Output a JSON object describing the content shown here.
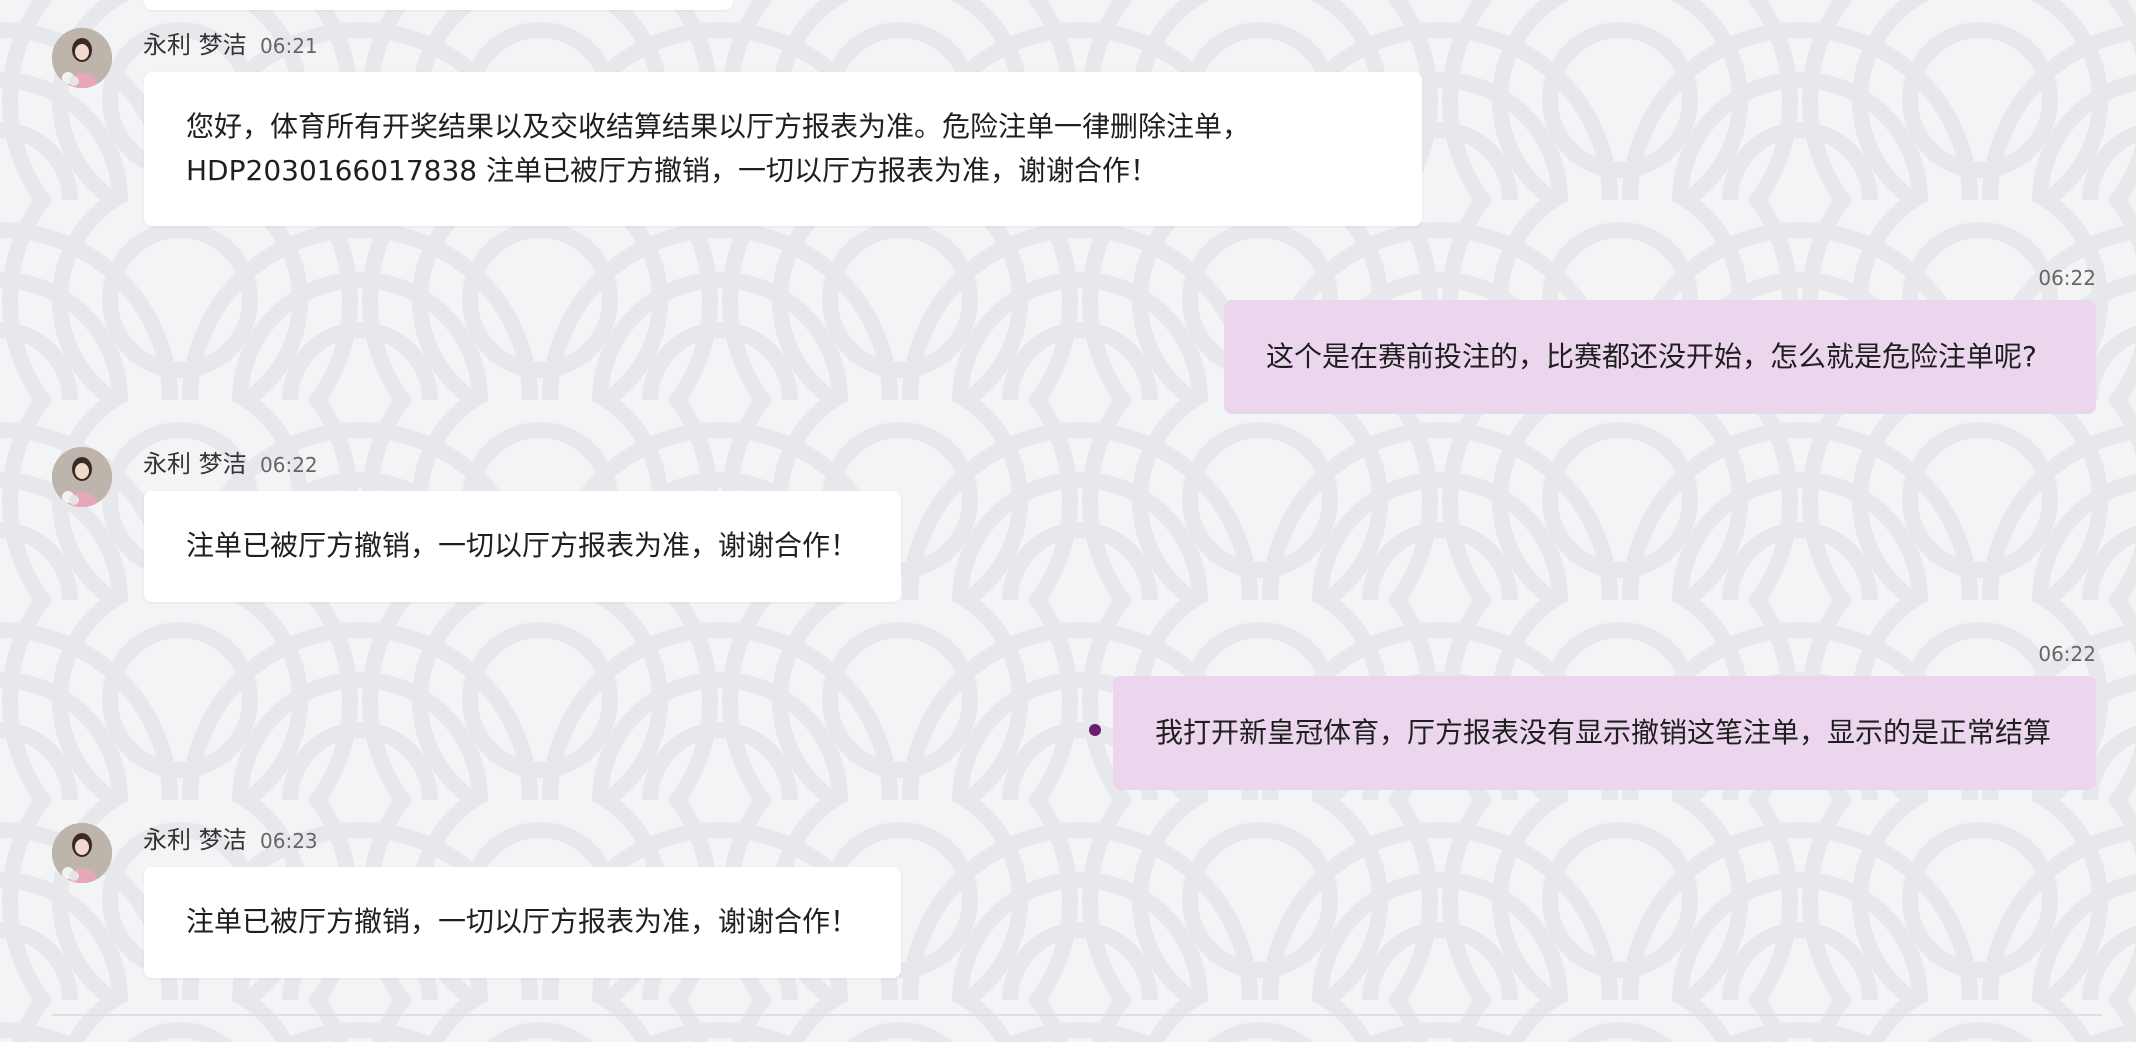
{
  "chat": {
    "messages": [
      {
        "direction": "incoming",
        "sender": "永利 梦洁",
        "time": "06:21",
        "text": "您好，体育所有开奖结果以及交收结算结果以厅方报表为准。危险注单一律删除注单，\nHDP2030166017838 注单已被厅方撤销，一切以厅方报表为准，谢谢合作！"
      },
      {
        "direction": "outgoing",
        "time": "06:22",
        "text": "这个是在赛前投注的，比赛都还没开始，怎么就是危险注单呢?"
      },
      {
        "direction": "incoming",
        "sender": "永利 梦洁",
        "time": "06:22",
        "text": "注单已被厅方撤销，一切以厅方报表为准，谢谢合作！"
      },
      {
        "direction": "outgoing",
        "time": "06:22",
        "text": "我打开新皇冠体育，厅方报表没有显示撤销这笔注单，显示的是正常结算",
        "unread_indicator": true
      },
      {
        "direction": "incoming",
        "sender": "永利 梦洁",
        "time": "06:23",
        "text": "注单已被厅方撤销，一切以厅方报表为准，谢谢合作！"
      }
    ]
  },
  "colors": {
    "background": "#f3f4f6",
    "incoming_bubble": "#ffffff",
    "outgoing_bubble": "#ecd6ee",
    "unread_dot": "#6a1d6c",
    "text": "#1f1f1f",
    "muted_text": "#666666"
  },
  "icons": {
    "avatar": "agent-avatar-photo",
    "status": "unread-dot-icon"
  }
}
